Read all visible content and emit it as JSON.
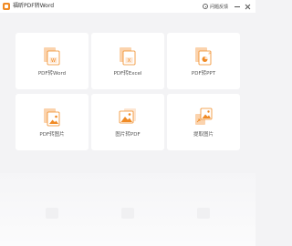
{
  "window": {
    "title": "福昕PDF转Word",
    "feedback_label": "问题反馈",
    "minimize_icon": "minimize-icon",
    "close_icon": "close-icon"
  },
  "colors": {
    "accent": "#f08a24",
    "accent_light": "#fbd3ad",
    "card_bg": "#ffffff",
    "page_bg": "#f3f3f5"
  },
  "tools": [
    {
      "label": "PDF转Word",
      "icon": "pdf-to-word-icon",
      "badge": "W"
    },
    {
      "label": "PDF转Excel",
      "icon": "pdf-to-excel-icon",
      "badge": "X"
    },
    {
      "label": "PDF转PPT",
      "icon": "pdf-to-ppt-icon",
      "badge": "P"
    },
    {
      "label": "PDF转图片",
      "icon": "pdf-to-image-icon",
      "badge": ""
    },
    {
      "label": "图片转PDF",
      "icon": "image-to-pdf-icon",
      "badge": ""
    },
    {
      "label": "提取图片",
      "icon": "extract-image-icon",
      "badge": ""
    }
  ]
}
